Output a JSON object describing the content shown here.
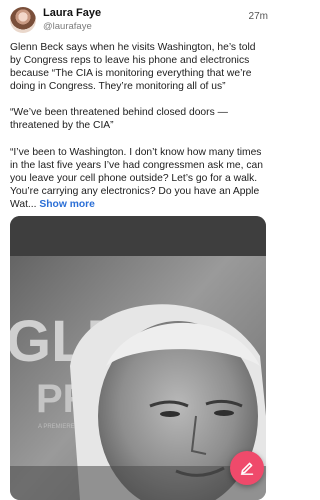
{
  "post": {
    "author_name": "Laura Faye",
    "author_handle": "@laurafaye",
    "time": "27m",
    "paragraph_1": "Glenn Beck says when he visits Washington, he’s told by Congress reps to leave his phone and electronics because “The CIA is monitoring everything that we’re doing in Congress. They’re monitoring all of us”",
    "paragraph_2": "“We’ve been threatened behind closed doors — threatened by the CIA”",
    "paragraph_3": "“I’ve been to Washington. I don’t know how many times in the last five years I’ve had congressmen ask me, can you leave your cell phone outside? Let’s go for a walk. You’re carrying any electronics? Do you have an Apple Wat...",
    "show_more": "Show more"
  },
  "media": {
    "backdrop_text_1": "GLE",
    "backdrop_text_2": "PR",
    "backdrop_small": "A PREMIERE"
  },
  "fab": {
    "icon": "edit-icon",
    "color": "#ef4a6b"
  },
  "colors": {
    "link": "#2b6fd6",
    "text": "#1d1d1d",
    "muted": "#7b7b7b"
  }
}
